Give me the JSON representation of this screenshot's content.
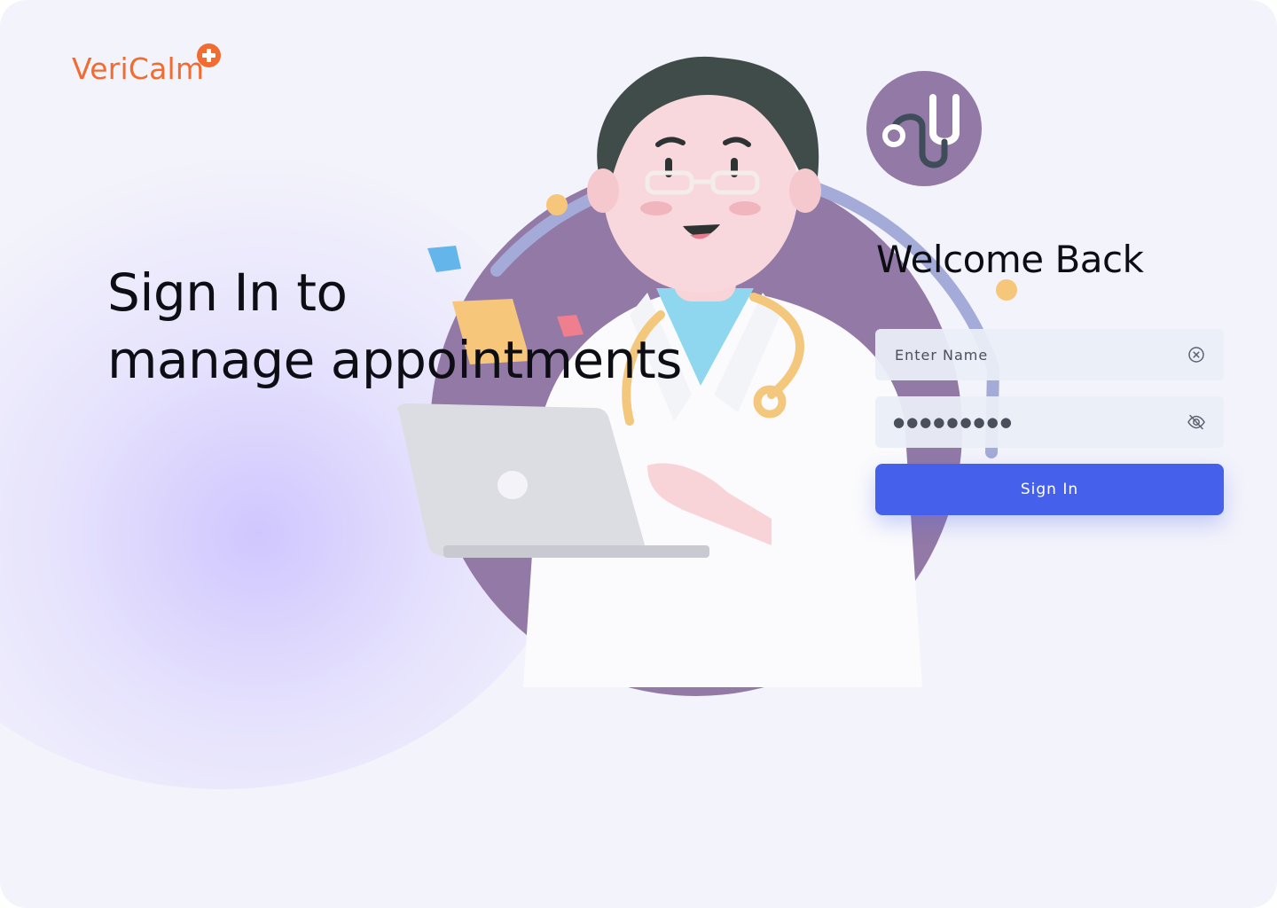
{
  "brand": {
    "name": "VeriCalm",
    "accent_color": "#f26b30",
    "badge_icon": "plus-icon"
  },
  "hero": {
    "line1": "Sign In to",
    "line2": "manage appointments"
  },
  "form": {
    "title": "Welcome Back",
    "name_placeholder": "Enter Name",
    "name_value": "",
    "password_mask": "●●●●●●●●●",
    "clear_icon": "clear-circle-icon",
    "visibility_icon": "eye-off-icon",
    "submit_label": "Sign In",
    "primary_color": "#4561ec"
  },
  "illustration": {
    "subject": "doctor-with-laptop",
    "badge_icon": "stethoscope-icon"
  }
}
